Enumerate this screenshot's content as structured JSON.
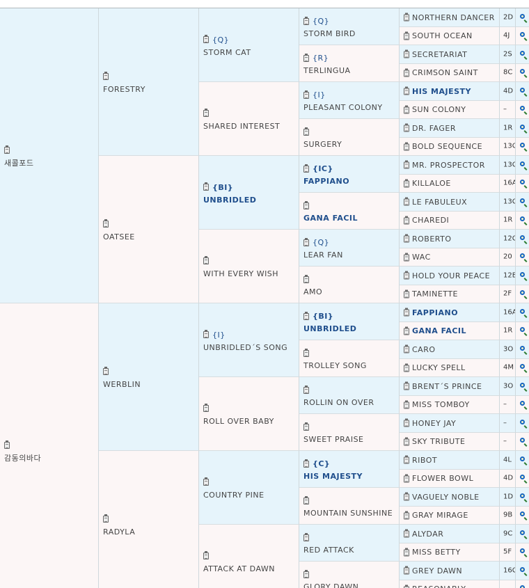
{
  "gen1": [
    {
      "name": "새콜포드",
      "bold": false,
      "side": "s"
    },
    {
      "name": "감동의바다",
      "bold": false,
      "side": "d"
    }
  ],
  "gen2": [
    {
      "name": "FORESTRY",
      "bold": false,
      "side": "s"
    },
    {
      "name": "OATSEE",
      "bold": false,
      "side": "d"
    },
    {
      "name": "WERBLIN",
      "bold": false,
      "side": "s"
    },
    {
      "name": "RADYLA",
      "bold": false,
      "side": "d"
    }
  ],
  "gen3": [
    {
      "tag": "{Q}",
      "name": "STORM CAT",
      "bold": false,
      "side": "s"
    },
    {
      "tag": "",
      "name": "SHARED INTEREST",
      "bold": false,
      "side": "d"
    },
    {
      "tag": "{BI}",
      "name": "UNBRIDLED",
      "bold": true,
      "side": "s"
    },
    {
      "tag": "",
      "name": "WITH EVERY WISH",
      "bold": false,
      "side": "d"
    },
    {
      "tag": "{I}",
      "name": "UNBRIDLED´S SONG",
      "bold": false,
      "side": "s"
    },
    {
      "tag": "",
      "name": "ROLL OVER BABY",
      "bold": false,
      "side": "d"
    },
    {
      "tag": "",
      "name": "COUNTRY PINE",
      "bold": false,
      "side": "s"
    },
    {
      "tag": "",
      "name": "ATTACK AT DAWN",
      "bold": false,
      "side": "d"
    }
  ],
  "gen4": [
    {
      "tag": "{Q}",
      "name": "STORM BIRD",
      "bold": false,
      "side": "s"
    },
    {
      "tag": "{R}",
      "name": "TERLINGUA",
      "bold": false,
      "side": "d"
    },
    {
      "tag": "{I}",
      "name": "PLEASANT COLONY",
      "bold": false,
      "side": "s"
    },
    {
      "tag": "",
      "name": "SURGERY",
      "bold": false,
      "side": "d"
    },
    {
      "tag": "{IC}",
      "name": "FAPPIANO",
      "bold": true,
      "side": "s"
    },
    {
      "tag": "",
      "name": "GANA FACIL",
      "bold": true,
      "side": "d"
    },
    {
      "tag": "{Q}",
      "name": "LEAR FAN",
      "bold": false,
      "side": "s"
    },
    {
      "tag": "",
      "name": "AMO",
      "bold": false,
      "side": "d"
    },
    {
      "tag": "{BI}",
      "name": "UNBRIDLED",
      "bold": true,
      "side": "s"
    },
    {
      "tag": "",
      "name": "TROLLEY SONG",
      "bold": false,
      "side": "d"
    },
    {
      "tag": "",
      "name": "ROLLIN ON OVER",
      "bold": false,
      "side": "s"
    },
    {
      "tag": "",
      "name": "SWEET PRAISE",
      "bold": false,
      "side": "d"
    },
    {
      "tag": "{C}",
      "name": "HIS MAJESTY",
      "bold": true,
      "side": "s"
    },
    {
      "tag": "",
      "name": "MOUNTAIN SUNSHINE",
      "bold": false,
      "side": "d"
    },
    {
      "tag": "",
      "name": "RED ATTACK",
      "bold": false,
      "side": "s"
    },
    {
      "tag": "",
      "name": "GLORY DAWN",
      "bold": false,
      "side": "d"
    }
  ],
  "gen5": [
    {
      "name": "NORTHERN DANCER",
      "code": "2D",
      "bold": false,
      "side": "s"
    },
    {
      "name": "SOUTH OCEAN",
      "code": "4J",
      "bold": false,
      "side": "d"
    },
    {
      "name": "SECRETARIAT",
      "code": "2S",
      "bold": false,
      "side": "s"
    },
    {
      "name": "CRIMSON SAINT",
      "code": "8C",
      "bold": false,
      "side": "d"
    },
    {
      "name": "HIS MAJESTY",
      "code": "4D",
      "bold": true,
      "side": "s"
    },
    {
      "name": "SUN COLONY",
      "code": "–",
      "bold": false,
      "side": "d"
    },
    {
      "name": "DR. FAGER",
      "code": "1R",
      "bold": false,
      "side": "s"
    },
    {
      "name": "BOLD SEQUENCE",
      "code": "13C",
      "bold": false,
      "side": "d"
    },
    {
      "name": "MR. PROSPECTOR",
      "code": "13C",
      "bold": false,
      "side": "s"
    },
    {
      "name": "KILLALOE",
      "code": "16A",
      "bold": false,
      "side": "d"
    },
    {
      "name": "LE FABULEUX",
      "code": "13C",
      "bold": false,
      "side": "s"
    },
    {
      "name": "CHAREDI",
      "code": "1R",
      "bold": false,
      "side": "d"
    },
    {
      "name": "ROBERTO",
      "code": "12C",
      "bold": false,
      "side": "s"
    },
    {
      "name": "WAC",
      "code": "20",
      "bold": false,
      "side": "d"
    },
    {
      "name": "HOLD YOUR PEACE",
      "code": "12B",
      "bold": false,
      "side": "s"
    },
    {
      "name": "TAMINETTE",
      "code": "2F",
      "bold": false,
      "side": "d"
    },
    {
      "name": "FAPPIANO",
      "code": "16A",
      "bold": true,
      "side": "s"
    },
    {
      "name": "GANA FACIL",
      "code": "1R",
      "bold": true,
      "side": "d"
    },
    {
      "name": "CARO",
      "code": "3O",
      "bold": false,
      "side": "s"
    },
    {
      "name": "LUCKY SPELL",
      "code": "4M",
      "bold": false,
      "side": "d"
    },
    {
      "name": "BRENT´S PRINCE",
      "code": "3O",
      "bold": false,
      "side": "s"
    },
    {
      "name": "MISS TOMBOY",
      "code": "–",
      "bold": false,
      "side": "d"
    },
    {
      "name": "HONEY JAY",
      "code": "–",
      "bold": false,
      "side": "s"
    },
    {
      "name": "SKY TRIBUTE",
      "code": "–",
      "bold": false,
      "side": "d"
    },
    {
      "name": "RIBOT",
      "code": "4L",
      "bold": false,
      "side": "s"
    },
    {
      "name": "FLOWER BOWL",
      "code": "4D",
      "bold": false,
      "side": "d"
    },
    {
      "name": "VAGUELY NOBLE",
      "code": "1D",
      "bold": false,
      "side": "s"
    },
    {
      "name": "GRAY MIRAGE",
      "code": "9B",
      "bold": false,
      "side": "d"
    },
    {
      "name": "ALYDAR",
      "code": "9C",
      "bold": false,
      "side": "s"
    },
    {
      "name": "MISS BETTY",
      "code": "5F",
      "bold": false,
      "side": "d"
    },
    {
      "name": "GREY DAWN",
      "code": "16C",
      "bold": false,
      "side": "s"
    },
    {
      "name": "REASONABLY",
      "code": "",
      "bold": false,
      "side": "d"
    }
  ],
  "icons": {
    "clipboard": "clipboard-icon",
    "search": "magnifier-icon"
  },
  "colors": {
    "sire_bg": "#e6f4fb",
    "dam_bg": "#fcf6f6",
    "bold_name": "#1f4e8c"
  }
}
